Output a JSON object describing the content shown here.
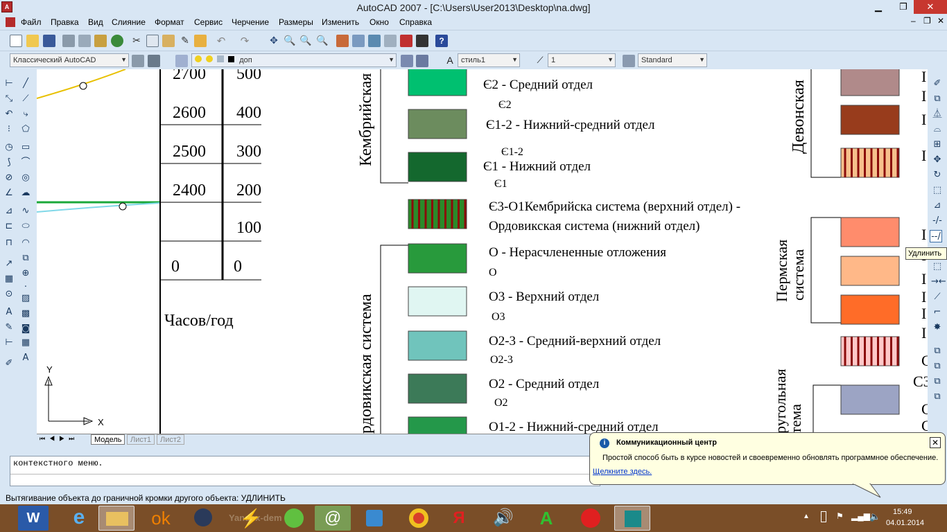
{
  "window": {
    "title": "AutoCAD 2007 - [C:\\Users\\User2013\\Desktop\\na.dwg]",
    "min": "▁",
    "restore": "❐",
    "close": "✕",
    "inner_min": "–",
    "inner_restore": "❐",
    "inner_close": "✕"
  },
  "menu": [
    "Файл",
    "Правка",
    "Вид",
    "Слияние",
    "Формат",
    "Сервис",
    "Черчение",
    "Размеры",
    "Изменить",
    "Окно",
    "Справка"
  ],
  "toolbar2": {
    "workspace": "Классический AutoCAD",
    "layer": "доп",
    "textstyle": "стиль1",
    "dimscale": "1",
    "tablestyle": "Standard"
  },
  "tooltip": "Удлинить",
  "drawing": {
    "table_rows": [
      {
        "left": "2700",
        "right": "500"
      },
      {
        "left": "2600",
        "right": "400"
      },
      {
        "left": "2500",
        "right": "300"
      },
      {
        "left": "2400",
        "right": "200"
      },
      {
        "left": "",
        "right": "100"
      },
      {
        "left": "0",
        "right": "0"
      }
    ],
    "unit_label": "Часов/год",
    "vertical_labels": {
      "cambrian": "Кембрийская",
      "ordovician": "рдовикская система",
      "devonian": "Девонская",
      "permian_1": "Пермская",
      "permian_2": "система",
      "carb_1": "ругольная",
      "carb_2": "тема"
    },
    "legend": [
      {
        "sym": "Є2",
        "title": "Є2 - Средний отдел",
        "sub": "Є2",
        "color": "#00c070",
        "hatch": false
      },
      {
        "sym": "Є1-2",
        "title": "Є1-2 -  Нижний-средний отдел",
        "sub": "Є1-2",
        "color": "#6c8c5e",
        "hatch": false
      },
      {
        "sym": "Є1",
        "title": "Є1 - Нижний отдел",
        "sub": "Є1",
        "color": "#14682e",
        "hatch": false
      },
      {
        "sym": "Є3-O1",
        "title": "Є3-O1Кембрийска система (верхний отдел) -",
        "title2": "Ордовикская система (нижний отдел)",
        "sub": "",
        "color": "#2a8a2a",
        "hatch": true
      },
      {
        "sym": "O",
        "title": "O - Нерасчлененные отложения",
        "sub": "O",
        "color": "#289a3c",
        "hatch": false
      },
      {
        "sym": "O3",
        "title": "O3 -  Верхний отдел",
        "sub": "O3",
        "color": "#e0f6f2",
        "hatch": false
      },
      {
        "sym": "O2-3",
        "title": "O2-3 - Средний-верхний отдел",
        "sub": "O2-3",
        "color": "#70c4bc",
        "hatch": false
      },
      {
        "sym": "O2",
        "title": "O2 - Средний отдел",
        "sub": "O2",
        "color": "#3c7a58",
        "hatch": false
      },
      {
        "sym": "O1-2",
        "title": "O1-2 -  Нижний-средний отдел",
        "sub": "",
        "color": "#24984a",
        "hatch": false
      }
    ],
    "right_swatches": [
      {
        "color": "#b08a8a",
        "hatch": false
      },
      {
        "color": "#983c1c",
        "hatch": false
      },
      {
        "color": "#f6c08c",
        "hatch": true
      },
      {
        "color": "#ff8c6c",
        "hatch": false
      },
      {
        "color": "#ffb888",
        "hatch": false
      },
      {
        "color": "#ff6c28",
        "hatch": false
      },
      {
        "color": "#ffc8c8",
        "hatch": true
      },
      {
        "color": "#9ca4c4",
        "hatch": false
      }
    ],
    "right_edge_letters": [
      "I",
      "I",
      "I",
      "I",
      "I",
      "I",
      "I",
      "I",
      "I",
      "I",
      "С",
      "С3",
      "С",
      "С"
    ],
    "ucs": {
      "y": "Y",
      "x": "X"
    }
  },
  "tabs": {
    "model": "Модель",
    "sheet1": "Лист1",
    "sheet2": "Лист2"
  },
  "command": {
    "line1": "контекстного меню."
  },
  "status": "Вытягивание объекта до граничной кромки другого объекта:  УДЛИНИТЬ",
  "balloon": {
    "title": "Коммуникационный центр",
    "body": "Простой способ быть в курсе новостей и своевременно обновлять программное обеспечение.",
    "link": "Щелкните здесь."
  },
  "tray": {
    "time": "15:49",
    "date": "04.01.2014"
  },
  "taskbar_watermark": "Yandex-dem",
  "colors": {
    "chrome": "#d8e6f4",
    "taskbar": "#7a4e28",
    "hatch": "#8a0a0a"
  }
}
